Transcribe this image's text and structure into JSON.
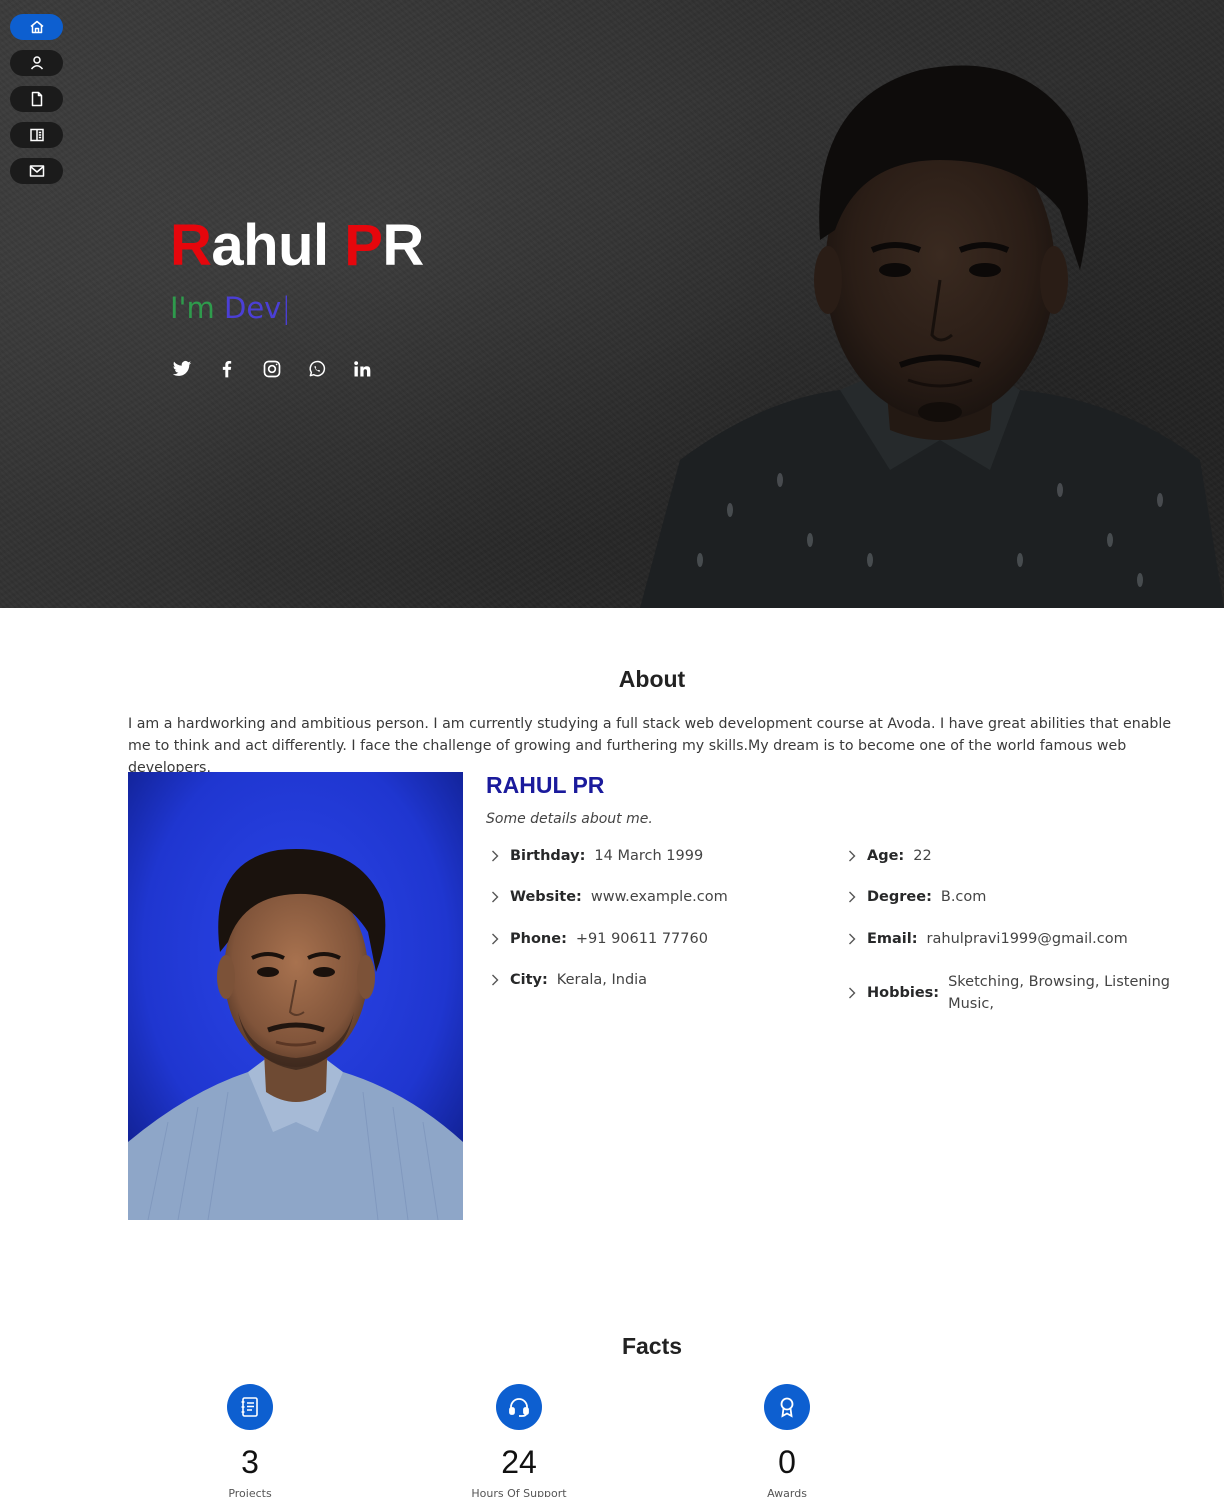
{
  "nav": {
    "items": [
      {
        "name": "home",
        "icon": "home-icon",
        "active": true
      },
      {
        "name": "about",
        "icon": "person-icon",
        "active": false
      },
      {
        "name": "resume",
        "icon": "file-icon",
        "active": false
      },
      {
        "name": "portfolio",
        "icon": "book-icon",
        "active": false
      },
      {
        "name": "contact",
        "icon": "envelope-icon",
        "active": false
      }
    ]
  },
  "hero": {
    "name_first_initial": "R",
    "name_first_rest": "ahul ",
    "name_last_initial": "P",
    "name_last_rest": "R",
    "typed_prefix": "I'm ",
    "typed_word": "Dev",
    "typed_cursor": "|",
    "socials": [
      "twitter-icon",
      "facebook-icon",
      "instagram-icon",
      "whatsapp-icon",
      "linkedin-icon"
    ]
  },
  "about": {
    "title": "About",
    "text": "I am a hardworking and ambitious person. I am currently studying a full stack web development course at Avoda. I have great abilities that enable me to think and act differently. I face the challenge of growing and furthering my skills.My dream is to become one of the world famous web developers.",
    "name": "RAHUL PR",
    "subtitle": "Some details about me.",
    "left": [
      {
        "label": "Birthday:",
        "value": "14 March 1999"
      },
      {
        "label": "Website:",
        "value": "www.example.com"
      },
      {
        "label": "Phone:",
        "value": "+91 90611 77760"
      },
      {
        "label": "City:",
        "value": "Kerala, India"
      }
    ],
    "right": [
      {
        "label": "Age:",
        "value": "22"
      },
      {
        "label": "Degree:",
        "value": "B.com"
      },
      {
        "label": "Email:",
        "value": "rahulpravi1999@gmail.com"
      },
      {
        "label": "Hobbies:",
        "value": "Sketching, Browsing, Listening Music,"
      }
    ]
  },
  "facts": {
    "title": "Facts",
    "items": [
      {
        "icon": "journal-icon",
        "number": "3",
        "label": "Projects"
      },
      {
        "icon": "headset-icon",
        "number": "24",
        "label": "Hours Of Support"
      },
      {
        "icon": "award-icon",
        "number": "0",
        "label": "Awards"
      }
    ]
  },
  "colors": {
    "accent": "#0d5fd0",
    "name_red": "#e6060c",
    "typed_green": "#2e9b4c",
    "typed_blue": "#4b3fd6",
    "details_name": "#1a1a9c"
  }
}
